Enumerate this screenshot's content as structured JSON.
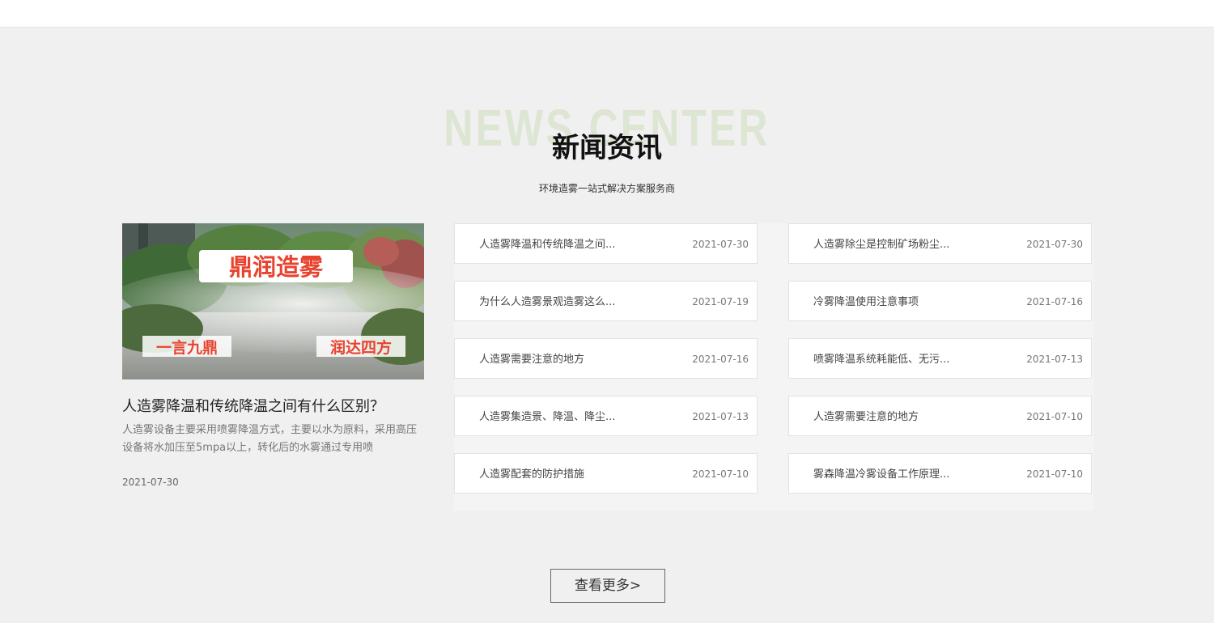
{
  "section": {
    "bg_title": "NEWS CENTER",
    "title": "新闻资讯",
    "subtitle": "环境造雾一站式解决方案服务商"
  },
  "featured": {
    "image_banner": "鼎润造雾",
    "image_left_text": "一言九鼎",
    "image_right_text": "润达四方",
    "title": "人造雾降温和传统降温之间有什么区别？",
    "description": "人造雾设备主要采用喷雾降温方式，主要以水为原料，采用高压设备将水加压至5mpa以上，转化后的水雾通过专用喷",
    "date": "2021-07-30"
  },
  "news_left": [
    {
      "title": "人造雾降温和传统降温之间...",
      "date": "2021-07-30"
    },
    {
      "title": "为什么人造雾景观造雾这么...",
      "date": "2021-07-19"
    },
    {
      "title": "人造雾需要注意的地方",
      "date": "2021-07-16"
    },
    {
      "title": "人造雾集造景、降温、降尘...",
      "date": "2021-07-13"
    },
    {
      "title": "人造雾配套的防护措施",
      "date": "2021-07-10"
    }
  ],
  "news_right": [
    {
      "title": "人造雾除尘是控制矿场粉尘...",
      "date": "2021-07-30"
    },
    {
      "title": "冷雾降温使用注意事项",
      "date": "2021-07-16"
    },
    {
      "title": "喷雾降温系统耗能低、无污...",
      "date": "2021-07-13"
    },
    {
      "title": "人造雾需要注意的地方",
      "date": "2021-07-10"
    },
    {
      "title": "雾森降温冷雾设备工作原理...",
      "date": "2021-07-10"
    }
  ],
  "more_button": {
    "label": "查看更多>"
  },
  "colors": {
    "background": "#f0f0f0",
    "watermark": "#dde5d3",
    "banner_text": "#e8432f"
  }
}
